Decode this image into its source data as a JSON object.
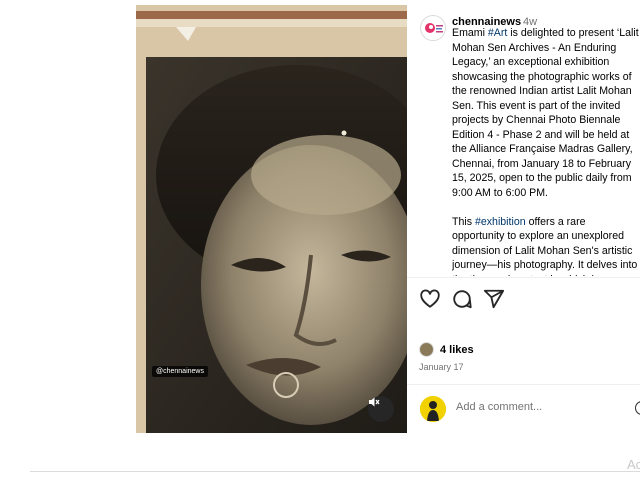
{
  "post": {
    "media": {
      "watermark": "@chennainews",
      "mute_icon": "speaker-muted-icon"
    },
    "author": {
      "username": "chennainews",
      "age": "4w"
    },
    "caption": {
      "p1_before": "Emami ",
      "hashtag1": "#Art",
      "p1_after": " is delighted to present ‘Lalit Mohan Sen Archives - An Enduring Legacy,’ an exceptional exhibition showcasing the photographic works of the renowned Indian artist Lalit Mohan Sen. This event is part of the invited projects by Chennai Photo Biennale Edition 4 - Phase 2 and will be held at the Alliance Française Madras Gallery, Chennai, from January 18 to February 15, 2025, open to the public daily from 9:00 AM to 6:00 PM.",
      "p2_before": "This ",
      "hashtag2": "#exhibition",
      "p2_after": " offers a rare opportunity to explore an unexplored dimension of Lalit Mohan Sen's artistic journey—his photography. It delves into the time and context in which he"
    },
    "actions": {
      "like_icon": "heart-icon",
      "comment_icon": "comment-icon",
      "share_icon": "share-icon"
    },
    "likes": "4 likes",
    "date": "January 17",
    "comment": {
      "placeholder": "Add a comment..."
    }
  },
  "os": {
    "activate_text": "Ac"
  },
  "colors": {
    "hashtag": "#00376b",
    "secondary_text": "#737373",
    "divider": "#efefef"
  }
}
